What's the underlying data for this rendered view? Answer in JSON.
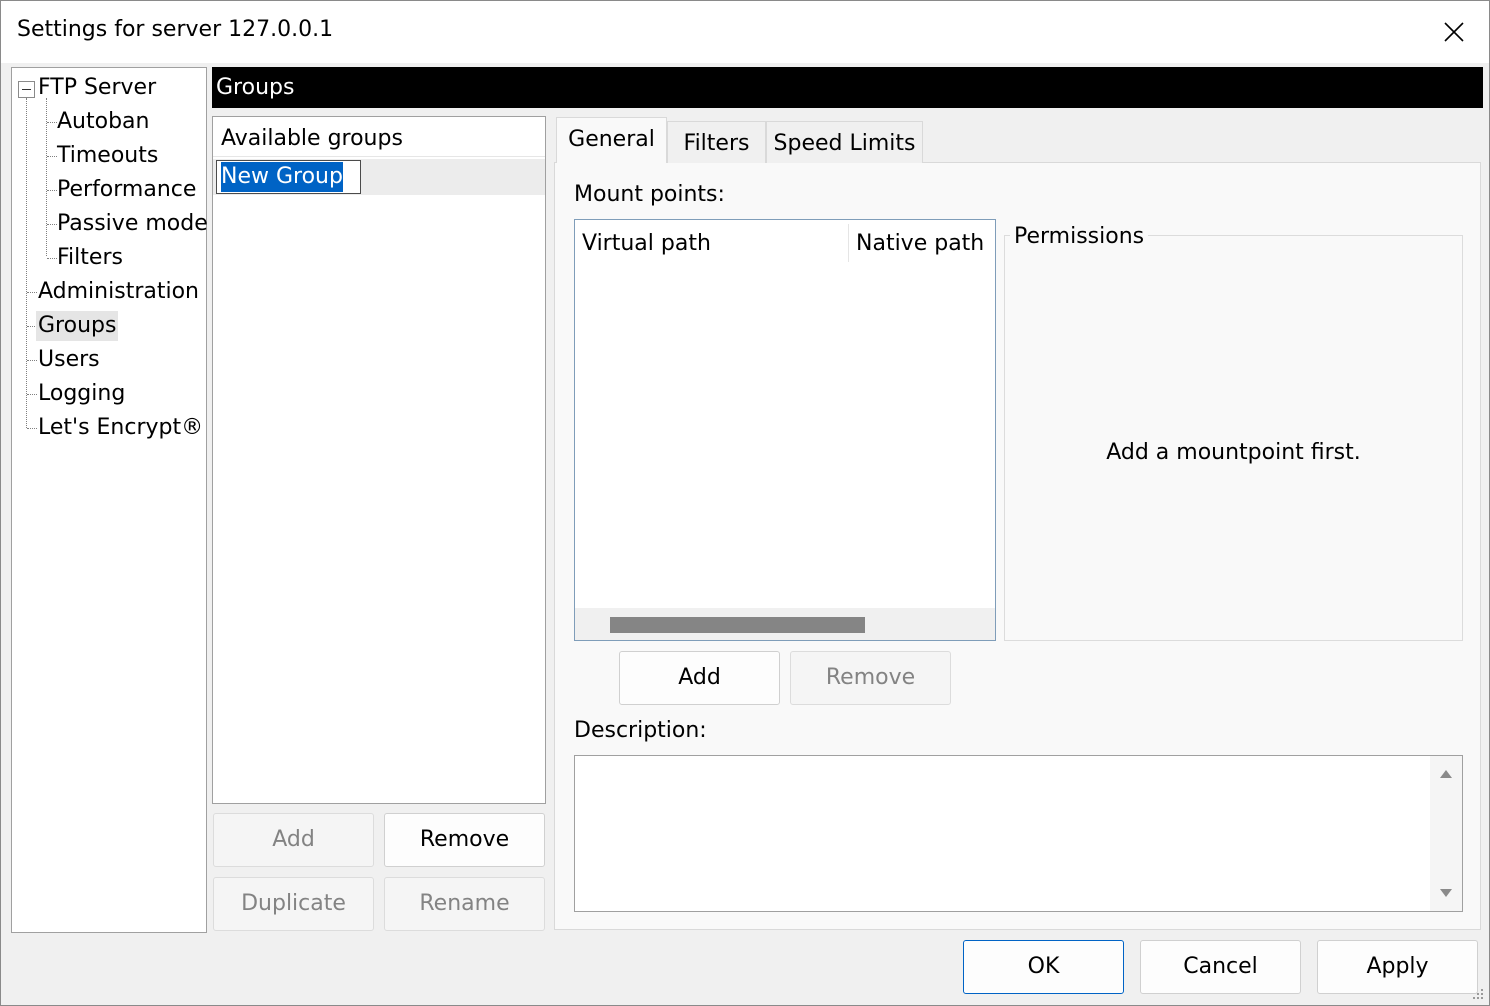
{
  "window": {
    "title": "Settings for server 127.0.0.1"
  },
  "tree": {
    "items": [
      {
        "label": "FTP Server",
        "expanded": true
      },
      {
        "label": "Autoban"
      },
      {
        "label": "Timeouts"
      },
      {
        "label": "Performance"
      },
      {
        "label": "Passive mode"
      },
      {
        "label": "Filters"
      },
      {
        "label": "Administration"
      },
      {
        "label": "Groups",
        "selected": true
      },
      {
        "label": "Users"
      },
      {
        "label": "Logging"
      },
      {
        "label": "Let's Encrypt®"
      }
    ]
  },
  "section": {
    "title": "Groups"
  },
  "groups": {
    "header": "Available groups",
    "items": [
      "New Group"
    ],
    "buttons": {
      "add": "Add",
      "remove": "Remove",
      "duplicate": "Duplicate",
      "rename": "Rename"
    }
  },
  "tabs": [
    {
      "label": "General",
      "active": true
    },
    {
      "label": "Filters"
    },
    {
      "label": "Speed Limits"
    }
  ],
  "general": {
    "mount_points_label": "Mount points:",
    "columns": [
      "Virtual path",
      "Native path"
    ],
    "permissions_title": "Permissions",
    "permissions_message": "Add a mountpoint first.",
    "add_button": "Add",
    "remove_button": "Remove",
    "description_label": "Description:",
    "description_value": ""
  },
  "footer": {
    "ok": "OK",
    "cancel": "Cancel",
    "apply": "Apply"
  }
}
